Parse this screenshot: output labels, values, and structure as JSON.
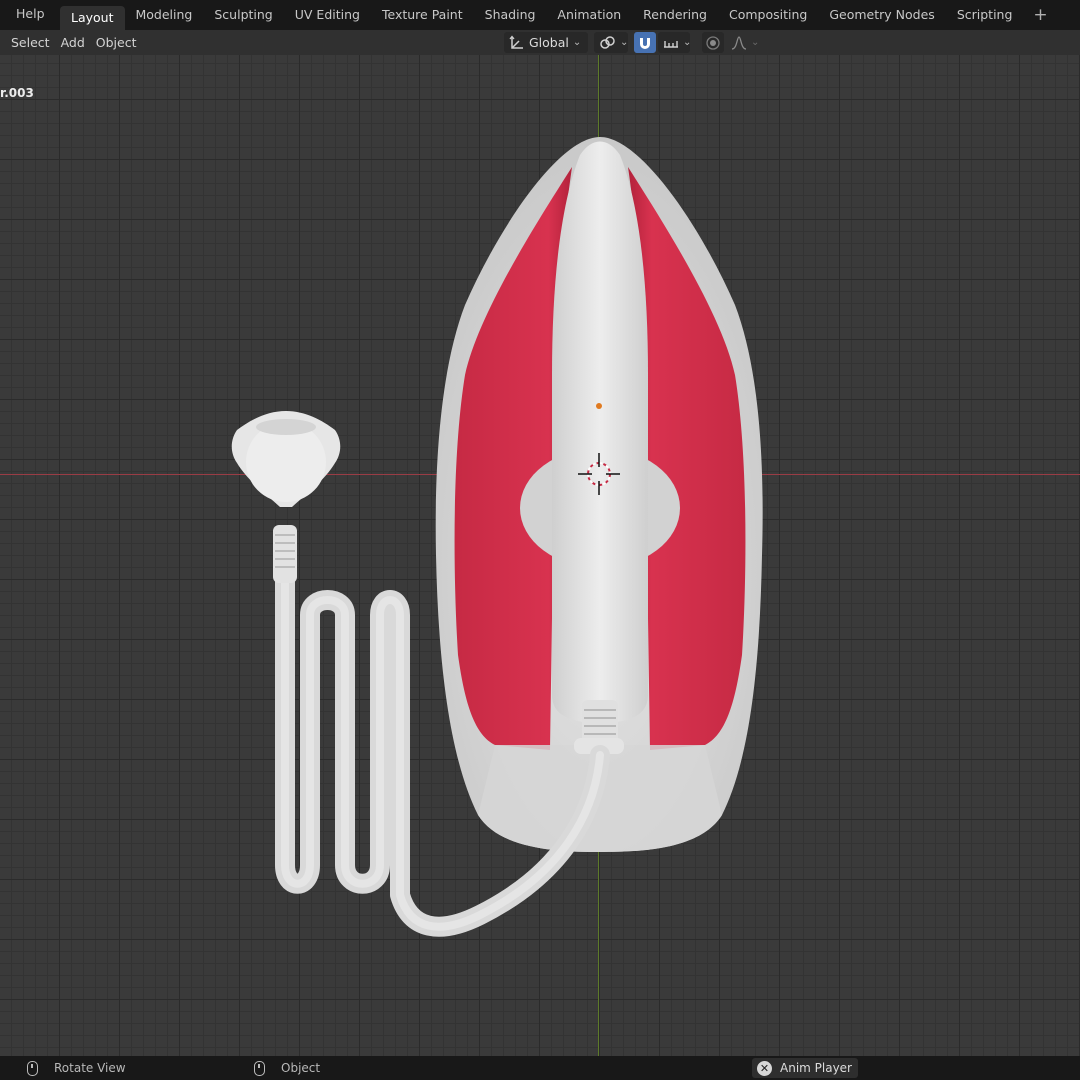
{
  "topbar": {
    "help_label": "Help",
    "tabs": [
      {
        "label": "Layout",
        "active": true
      },
      {
        "label": "Modeling"
      },
      {
        "label": "Sculpting"
      },
      {
        "label": "UV Editing"
      },
      {
        "label": "Texture Paint"
      },
      {
        "label": "Shading"
      },
      {
        "label": "Animation"
      },
      {
        "label": "Rendering"
      },
      {
        "label": "Compositing"
      },
      {
        "label": "Geometry Nodes"
      },
      {
        "label": "Scripting"
      }
    ],
    "add_tab_label": "+"
  },
  "header": {
    "menu": [
      "Select",
      "Add",
      "Object"
    ],
    "transform_orientation": "Global",
    "icons": {
      "orientation": "transform-orientation-icon",
      "pivot": "pivot-link-icon",
      "snap": "snap-magnet-icon",
      "snap_target": "snap-increment-icon",
      "proportional": "proportional-edit-icon",
      "falloff": "falloff-curve-icon"
    },
    "snap_active_color": "#4772b3"
  },
  "viewport": {
    "object_name": "r.003",
    "colors": {
      "grid_bg": "#3a3a3a",
      "x_axis": "#9a3c45",
      "y_axis": "#5d7a2a",
      "iron_red": "#c62a44",
      "iron_white": "#dcdcdc"
    }
  },
  "statusbar": {
    "rotate_label": "Rotate View",
    "object_label": "Object",
    "anim_player_label": "Anim Player"
  }
}
